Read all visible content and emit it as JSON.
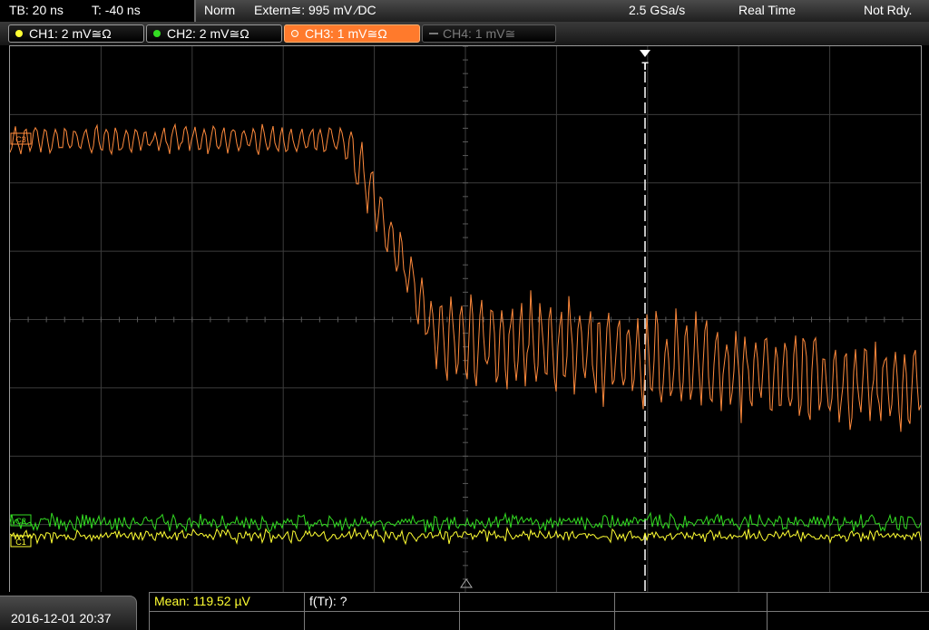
{
  "status": {
    "timebase": "TB: 20 ns",
    "trigger_time": "T: -40 ns",
    "trigger_mode": "Norm",
    "trigger_source": "Extern≅: 995 mV ⁄DC",
    "sample_rate": "2.5 GSa/s",
    "acq_mode": "Real Time",
    "state": "Not Rdy."
  },
  "channels": [
    {
      "label": "CH1: 2 mV≅Ω",
      "color": "#ffff33",
      "state": "on"
    },
    {
      "label": "CH2: 2 mV≅Ω",
      "color": "#33dd22",
      "state": "on"
    },
    {
      "label": "CH3: 1 mV≅Ω",
      "color": "#ff8a3c",
      "state": "selected"
    },
    {
      "label": "CH4: 1 mV≅",
      "color": "#7a7a7a",
      "state": "off"
    }
  ],
  "markers": {
    "ch3": "C3",
    "ch2": "C2",
    "ch1": "C1",
    "trigger": "T"
  },
  "bottom": {
    "datetime": "2016-12-01 20:37",
    "mean": "Mean: 119.52 µV",
    "f_tr": "f(Tr): ?"
  },
  "colors": {
    "ch1": "#ffff33",
    "ch2": "#33dd22",
    "ch3": "#ff8a3c",
    "grid": "#3c3c3c"
  }
}
